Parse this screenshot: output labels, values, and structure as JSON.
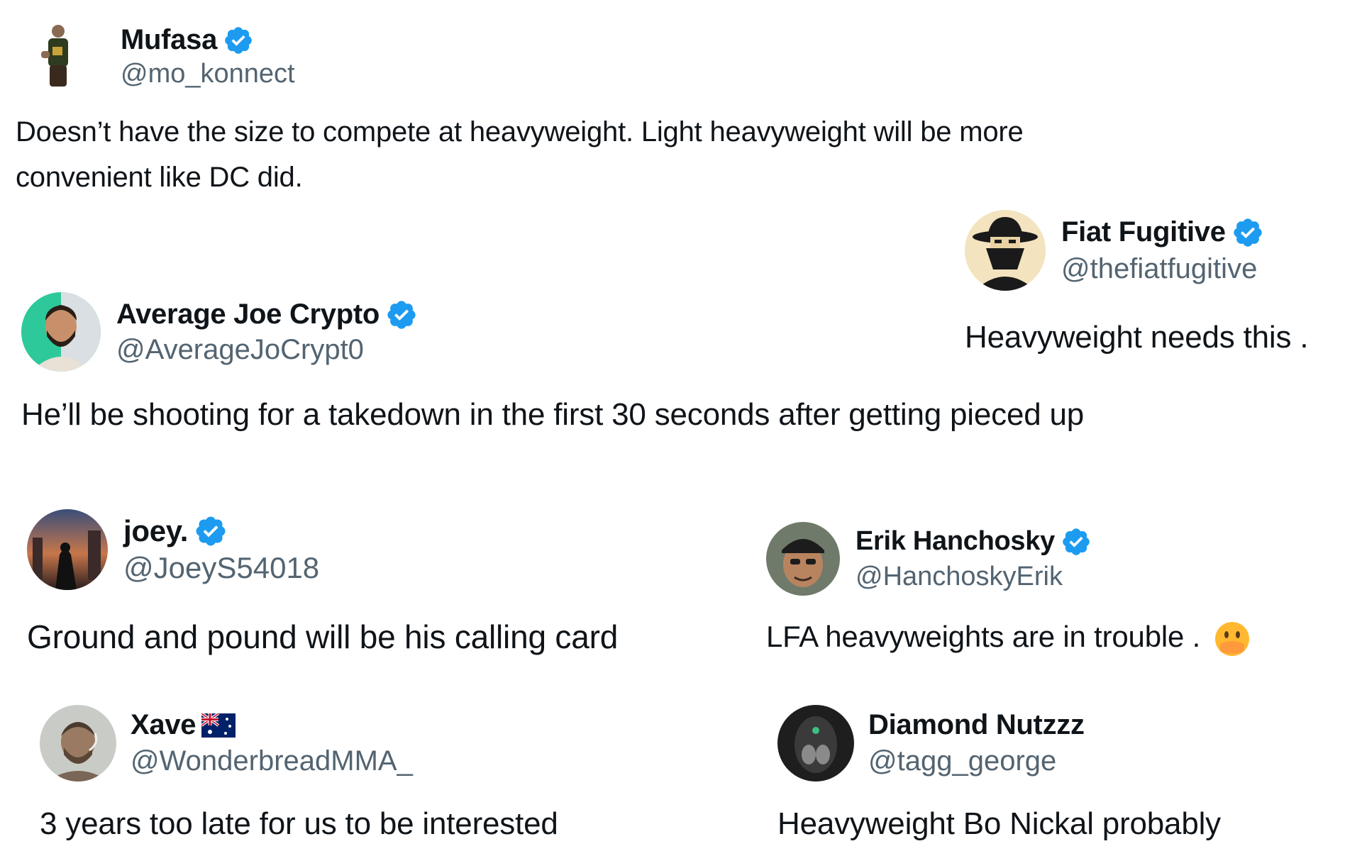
{
  "colors": {
    "text": "#0f1419",
    "handle": "#536471",
    "verified": "#1d9bf0",
    "background": "#ffffff"
  },
  "tweets": [
    {
      "name": "Mufasa",
      "handle": "@mo_konnect",
      "verified": true,
      "text": "Doesn’t have the size to compete at heavyweight. Light heavyweight will be more convenient like DC did.",
      "avatar_icon": "standing-man-avatar"
    },
    {
      "name": "Fiat Fugitive",
      "handle": "@thefiatfugitive",
      "verified": true,
      "text": "Heavyweight needs this .",
      "avatar_icon": "masked-cowboy-avatar"
    },
    {
      "name": "Average Joe Crypto",
      "handle": "@AverageJoCrypt0",
      "verified": true,
      "text": "He’ll be shooting for a takedown in the first 30 seconds after getting pieced up",
      "avatar_icon": "bearded-man-avatar"
    },
    {
      "name": "joey.",
      "handle": "@JoeyS54018",
      "verified": true,
      "text": "Ground and pound will be his calling card",
      "avatar_icon": "batman-city-avatar"
    },
    {
      "name": "Erik Hanchosky",
      "handle": "@HanchoskyErik",
      "verified": true,
      "text": "LFA heavyweights are in trouble .",
      "emoji": "hand-over-mouth-emoji",
      "avatar_icon": "man-with-cap-avatar"
    },
    {
      "name": "Xave",
      "handle": "@WonderbreadMMA_",
      "verified": false,
      "flag": "australia-flag-icon",
      "text": "3 years too late for us to be interested",
      "avatar_icon": "smoking-man-avatar"
    },
    {
      "name": "Diamond Nutzzz",
      "handle": "@tagg_george",
      "verified": false,
      "text": "Heavyweight Bo Nickal probably",
      "avatar_icon": "dark-figure-avatar"
    }
  ]
}
